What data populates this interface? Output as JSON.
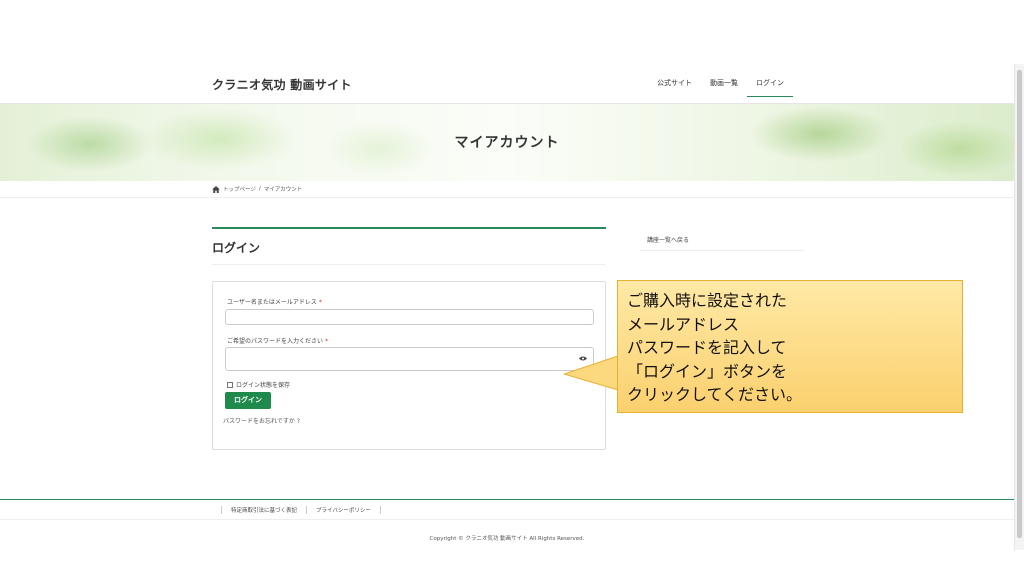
{
  "header": {
    "site_title": "クラニオ気功 動画サイト",
    "nav": [
      {
        "label": "公式サイト"
      },
      {
        "label": "動画一覧"
      },
      {
        "label": "ログイン",
        "active": true
      }
    ]
  },
  "hero": {
    "title": "マイアカウント"
  },
  "breadcrumb": {
    "home_icon": "home-icon",
    "home": "トップページ",
    "separator": "/",
    "current": "マイアカウント"
  },
  "login": {
    "heading": "ログイン",
    "username_label": "ユーザー名またはメールアドレス",
    "username_value": "",
    "password_label": "ご希望のパスワードを入力ください",
    "password_value": "",
    "required_mark": "*",
    "remember_label": "ログイン状態を保存",
    "remember_checked": false,
    "submit_label": "ログイン",
    "forgot_label": "パスワードをお忘れですか ?"
  },
  "sidebar": {
    "back_link": "講座一覧へ戻る"
  },
  "callout": {
    "lines": [
      "ご購入時に設定された",
      "メールアドレス",
      "パスワードを記入して",
      "「ログイン」ボタンを",
      "クリックしてください。"
    ],
    "fill_color": "#fbd06e",
    "border_color": "#e9b030"
  },
  "footer": {
    "links": [
      "特定商取引法に基づく表記",
      "プライバシーポリシー"
    ],
    "copyright": "Copyright © クラニオ気功 動画サイト All Rights Reserved."
  },
  "colors": {
    "accent": "#2a8a5b",
    "button": "#1f8a4c"
  }
}
